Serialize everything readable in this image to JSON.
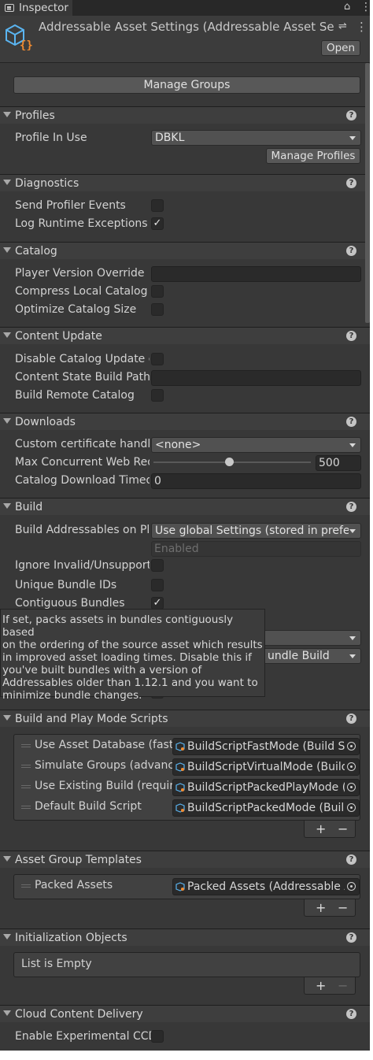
{
  "tab": {
    "label": "Inspector"
  },
  "header": {
    "title": "Addressable Asset Settings (Addressable Asset Settings)",
    "open_label": "Open"
  },
  "manage_groups_label": "Manage Groups",
  "sections": {
    "profiles": "Profiles",
    "diagnostics": "Diagnostics",
    "catalog": "Catalog",
    "content_update": "Content Update",
    "downloads": "Downloads",
    "build": "Build",
    "scripts": "Build and Play Mode Scripts",
    "templates": "Asset Group Templates",
    "init": "Initialization Objects",
    "ccd": "Cloud Content Delivery"
  },
  "help_glyph": "?",
  "profiles": {
    "label": "Profile In Use",
    "value": "DBKL",
    "manage_label": "Manage Profiles"
  },
  "diagnostics": {
    "send_profiler": {
      "label": "Send Profiler Events",
      "checked": false
    },
    "log_exceptions": {
      "label": "Log Runtime Exceptions",
      "checked": true
    }
  },
  "catalog": {
    "player_version": {
      "label": "Player Version Override",
      "value": ""
    },
    "compress": {
      "label": "Compress Local Catalog",
      "checked": false
    },
    "optimize": {
      "label": "Optimize Catalog Size",
      "checked": false
    }
  },
  "content_update": {
    "disable_catalog": {
      "label": "Disable Catalog Update on Startup",
      "checked": false
    },
    "state_path": {
      "label": "Content State Build Path",
      "value": ""
    },
    "build_remote": {
      "label": "Build Remote Catalog",
      "checked": false
    }
  },
  "downloads": {
    "cert_handler": {
      "label": "Custom certificate handler",
      "value": "<none>"
    },
    "max_web": {
      "label": "Max Concurrent Web Requests",
      "value": "500",
      "slider_fraction": 0.46
    },
    "timeout": {
      "label": "Catalog Download Timeout",
      "value": "0"
    }
  },
  "build": {
    "on_play": {
      "label": "Build Addressables on Player Build",
      "value": "Use global Settings (stored in preferences)"
    },
    "enabled_value": "Enabled",
    "ignore_invalid": {
      "label": "Ignore Invalid/Unsupported Files in Build",
      "checked": false
    },
    "unique_ids": {
      "label": "Unique Bundle IDs",
      "checked": false
    },
    "contiguous": {
      "label": "Contiguous Bundles",
      "checked": true
    },
    "partial_dropdown_text": "undle Build",
    "tooltip_lines": [
      "If set, packs assets in bundles contiguously based",
      "on the ordering of the source asset which results",
      "in improved asset loading times. Disable this if",
      "you've built bundles with a version of",
      "Addressables older than 1.12.1 and you want to",
      "minimize bundle changes."
    ]
  },
  "scripts": [
    {
      "label": "Use Asset Database (fastest)",
      "value": "BuildScriptFastMode (Build Script Fast Mode)"
    },
    {
      "label": "Simulate Groups (advanced)",
      "value": "BuildScriptVirtualMode (Build Script Virtual Mode)"
    },
    {
      "label": "Use Existing Build (requires built groups)",
      "value": "BuildScriptPackedPlayMode (Build Script Packed Play Mode)"
    },
    {
      "label": "Default Build Script",
      "value": "BuildScriptPackedMode (Build Script Packed Mode)"
    }
  ],
  "templates": [
    {
      "label": "Packed Assets",
      "value": "Packed Assets (Addressable Asset Group Template)"
    }
  ],
  "list_controls": {
    "plus": "+",
    "minus": "−"
  },
  "init": {
    "empty_text": "List is Empty"
  },
  "ccd": {
    "label": "Enable Experimental CCD",
    "checked": false
  },
  "icons": {
    "tab": "inspector-icon",
    "header": "addressable-settings-icon",
    "lock": "lock-icon",
    "kebab": "kebab-menu-icon",
    "settings": "preset-sliders-icon",
    "object": "scriptable-object-icon",
    "picker": "object-picker-icon"
  },
  "colors": {
    "panel": "#383838",
    "field": "#2a2a2a",
    "icon_blue": "#5ab4f0",
    "icon_orange": "#f08a30"
  }
}
